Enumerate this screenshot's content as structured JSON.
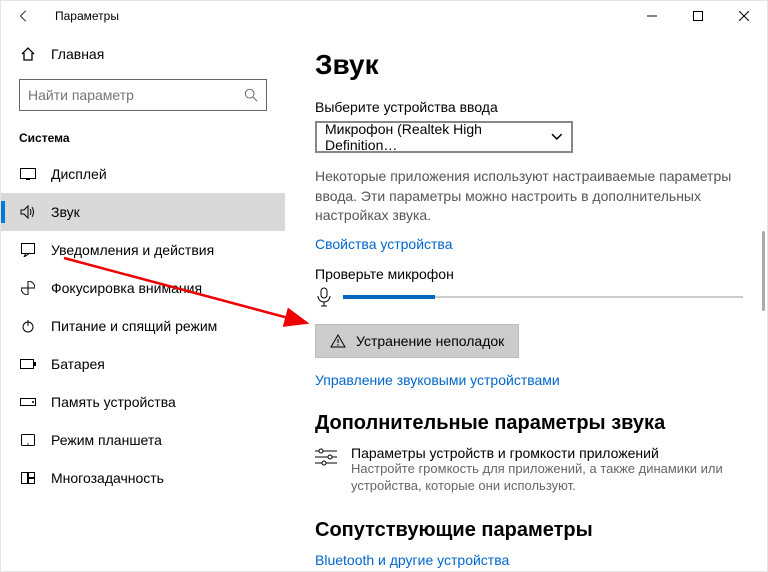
{
  "window": {
    "title": "Параметры"
  },
  "sidebar": {
    "home": "Главная",
    "searchPlaceholder": "Найти параметр",
    "section": "Система",
    "items": [
      {
        "label": "Дисплей"
      },
      {
        "label": "Звук"
      },
      {
        "label": "Уведомления и действия"
      },
      {
        "label": "Фокусировка внимания"
      },
      {
        "label": "Питание и спящий режим"
      },
      {
        "label": "Батарея"
      },
      {
        "label": "Память устройства"
      },
      {
        "label": "Режим планшета"
      },
      {
        "label": "Многозадачность"
      }
    ]
  },
  "content": {
    "heading": "Звук",
    "inputLabel": "Выберите устройства ввода",
    "inputDevice": "Микрофон (Realtek High Definition…",
    "note": "Некоторые приложения используют настраиваемые параметры ввода. Эти параметры можно настроить в дополнительных настройках звука.",
    "devicePropsLink": "Свойства устройства",
    "testMicLabel": "Проверьте микрофон",
    "troubleshoot": "Устранение неполадок",
    "manageDevicesLink": "Управление звуковыми устройствами",
    "advancedHeading": "Дополнительные параметры звука",
    "appVolumeTitle": "Параметры устройств и громкости приложений",
    "appVolumeDesc": "Настройте громкость для приложений, а также динамики или устройства, которые они используют.",
    "relatedHeading": "Сопутствующие параметры",
    "bluetoothLink": "Bluetooth и другие устройства"
  }
}
